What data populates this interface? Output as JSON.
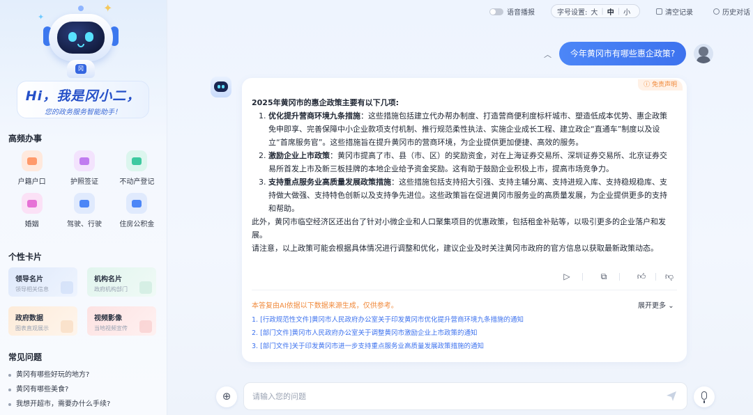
{
  "sidebar": {
    "greeting_title": "Hi，我是冈小二，",
    "greeting_subtitle": "您的政务服务智能助手！",
    "robot_badge": "冈",
    "frequent_title": "高频办事",
    "frequent_items": [
      {
        "label": "户籍户口",
        "icon": "household-icon",
        "color": "#ff9a6b"
      },
      {
        "label": "护照签证",
        "icon": "passport-icon",
        "color": "#c07bf0"
      },
      {
        "label": "不动产登记",
        "icon": "property-icon",
        "color": "#3ec9a0"
      },
      {
        "label": "婚姻",
        "icon": "marriage-icon",
        "color": "#e672d6"
      },
      {
        "label": "驾驶、行驶",
        "icon": "car-icon",
        "color": "#4c86f7"
      },
      {
        "label": "住房公积金",
        "icon": "housing-fund-icon",
        "color": "#4c86f7"
      }
    ],
    "cards_title": "个性卡片",
    "cards": [
      {
        "title": "领导名片",
        "subtitle": "领导相关信息"
      },
      {
        "title": "机构名片",
        "subtitle": "政府机构部门"
      },
      {
        "title": "政府数据",
        "subtitle": "图表直观展示"
      },
      {
        "title": "视频影像",
        "subtitle": "当地视频宣传"
      }
    ],
    "faq_title": "常见问题",
    "faq": [
      "黄冈有哪些好玩的地方?",
      "黄冈有哪些美食?",
      "我想开超市，需要办什么手续?"
    ]
  },
  "topbar": {
    "voice_label": "语音播报",
    "fontsize_label": "字号设置:",
    "fontsize_options": [
      "大",
      "中",
      "小"
    ],
    "fontsize_selected": "中",
    "clear_label": "清空记录",
    "history_label": "历史对话"
  },
  "chat": {
    "question": "今年黄冈市有哪些惠企政策?",
    "disclaimer": "免责声明",
    "answer_intro": "2025年黄冈市的惠企政策主要有以下几项:",
    "answer_items": [
      {
        "num": "1.",
        "title": "优化提升营商环境九条措施",
        "text": "：这些措施包括建立代办帮办制度、打造营商便利度标杆城市、塑造低成本优势、惠企政策免申即享、完善保障中小企业款项支付机制、推行规范柔性执法、实施企业成长工程、建立政企“直通车”制度以及设立“首席服务官”。这些措施旨在提升黄冈市的营商环境，为企业提供更加便捷、高效的服务。"
      },
      {
        "num": "2.",
        "title": "激励企业上市政策",
        "text": "：黄冈市提高了市、县（市、区）的奖励资金，对在上海证券交易所、深圳证券交易所、北京证券交易所首发上市及新三板挂牌的本地企业给予资金奖励。这有助于鼓励企业积极上市，提高市场竞争力。"
      },
      {
        "num": "3.",
        "title": "支持重点服务业高质量发展政策措施",
        "text": "：这些措施包括支持招大引强、支持主辅分离、支持进规入库、支持稳规稳库、支持做大做强、支持特色创新以及支持争先进位。这些政策旨在促进黄冈市服务业的高质量发展，为企业提供更多的支持和帮助。"
      }
    ],
    "answer_extra": "此外，黄冈市临空经济区还出台了针对小微企业和人口聚集项目的优惠政策，包括租金补贴等，以吸引更多的企业落户和发展。",
    "answer_note": "请注意，以上政策可能会根据具体情况进行调整和优化，建议企业及时关注黄冈市政府的官方信息以获取最新政策动态。",
    "source_note": "本答复由AI依据以下数据来源生成，仅供参考。",
    "expand_label": "展开更多",
    "sources": [
      "1. [行政规范性文件]黄冈市人民政府办公室关于印发黄冈市优化提升营商环境九条措施的通知",
      "2. [部门文件]黄冈市人民政府办公室关于调整黄冈市激励企业上市政策的通知",
      "3. [部门文件]关于印发黄冈市进一步支持重点服务业高质量发展政策措施的通知"
    ]
  },
  "input": {
    "placeholder": "请输入您的问题"
  },
  "colors": {
    "accent": "#3d72ee",
    "disclaimer": "#f08a3c"
  }
}
